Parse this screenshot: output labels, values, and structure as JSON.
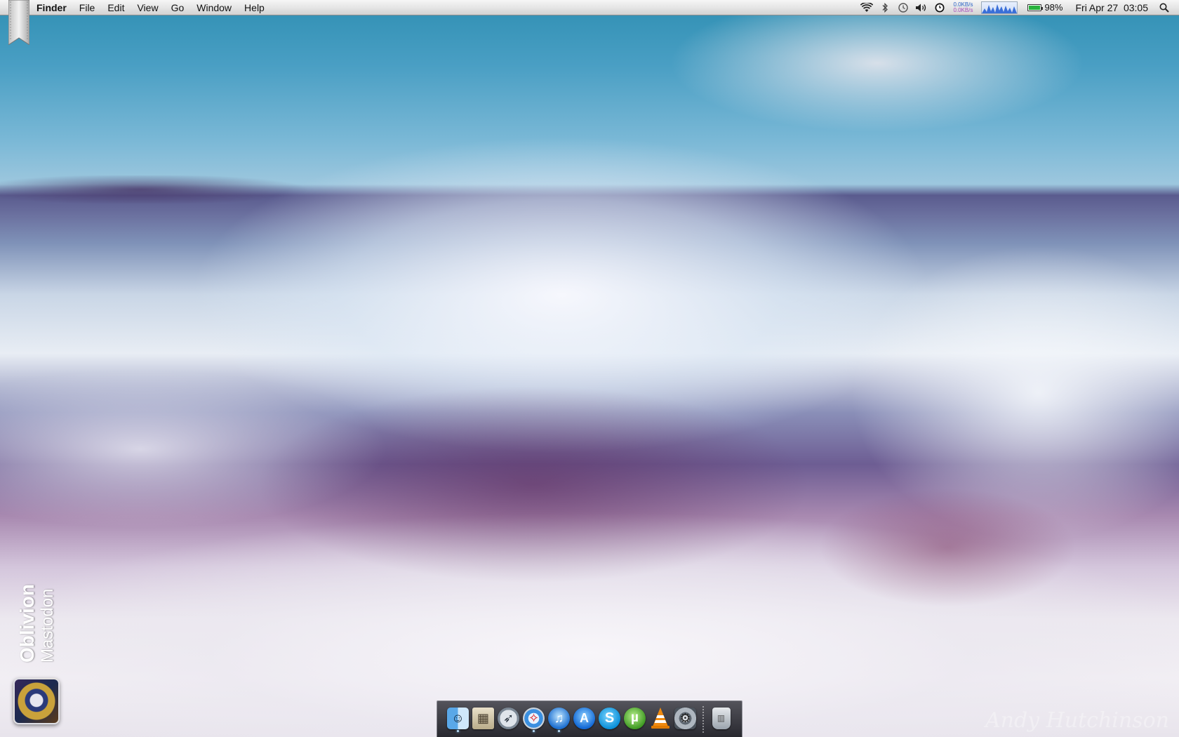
{
  "menubar": {
    "apple_icon": "apple-logo-icon",
    "app_name": "Finder",
    "menus": [
      "File",
      "Edit",
      "View",
      "Go",
      "Window",
      "Help"
    ],
    "status": {
      "wifi_icon": "wifi-icon",
      "bluetooth_icon": "bluetooth-icon",
      "time_machine_icon": "time-machine-icon",
      "volume_icon": "volume-icon",
      "clock_widget_icon": "clock-widget-icon",
      "net_up": "0.0KB/s",
      "net_down": "0.0KB/s",
      "cpu_graph_icon": "cpu-graph-icon",
      "battery_percent": "98%",
      "battery_level": 0.98,
      "datetime": "Fri Apr 27  03:05",
      "spotlight_icon": "spotlight-search-icon"
    }
  },
  "now_playing": {
    "title": "Oblivion",
    "artist": "Mastodon",
    "album_art_icon": "album-art"
  },
  "watermark": "Andy Hutchinson",
  "dock": {
    "items": [
      {
        "name": "finder",
        "icon": "finder-icon",
        "glyph": "☺",
        "running": true
      },
      {
        "name": "preview",
        "icon": "preview-icon",
        "glyph": "▦",
        "running": false
      },
      {
        "name": "launchpad",
        "icon": "launchpad-rocket-icon",
        "glyph": "➶",
        "running": false
      },
      {
        "name": "safari",
        "icon": "safari-compass-icon",
        "glyph": "✧",
        "running": true
      },
      {
        "name": "itunes",
        "icon": "itunes-note-icon",
        "glyph": "♫",
        "running": true
      },
      {
        "name": "app-store",
        "icon": "app-store-icon",
        "glyph": "A",
        "running": false
      },
      {
        "name": "skype",
        "icon": "skype-icon",
        "glyph": "S",
        "running": false
      },
      {
        "name": "utorrent",
        "icon": "utorrent-icon",
        "glyph": "µ",
        "running": false
      },
      {
        "name": "vlc",
        "icon": "vlc-cone-icon",
        "glyph": "",
        "running": false
      },
      {
        "name": "system-preferences",
        "icon": "gear-icon",
        "glyph": "⚙",
        "running": false
      }
    ],
    "trash": {
      "name": "trash",
      "icon": "trash-icon",
      "glyph": "▥"
    }
  },
  "colors": {
    "menubar_bg": "#e4e4e4",
    "dock_bg": "#2e2e35",
    "battery_green": "#28b23c",
    "running_indicator": "#bfe3ff"
  }
}
